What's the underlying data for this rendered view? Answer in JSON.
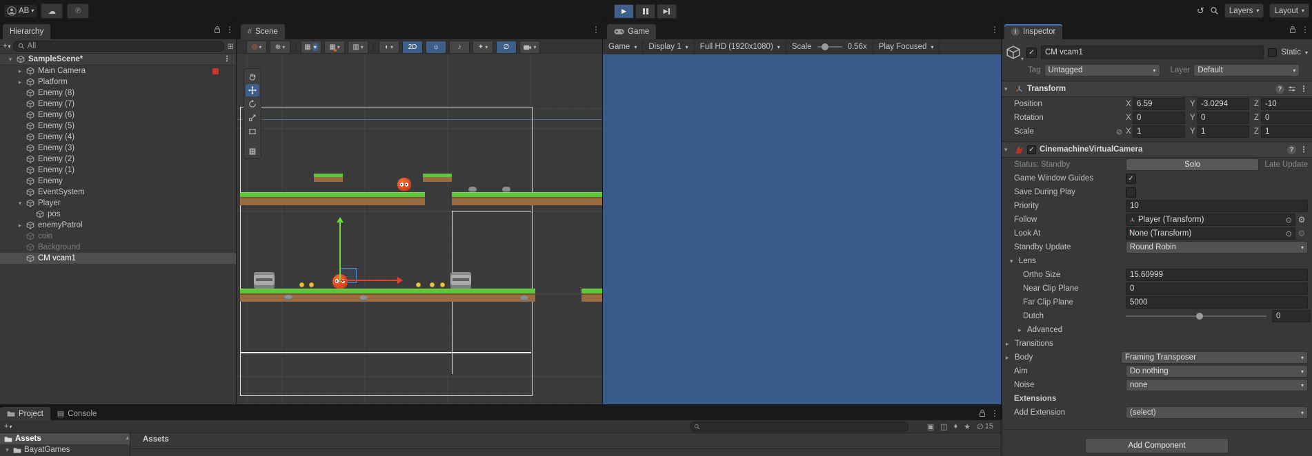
{
  "colors": {
    "chrome": "#191919",
    "panel": "#383838",
    "accent_blue": "#3d5f8a",
    "selection_gray": "#4d4d4d",
    "game_view_blue": "#3a5a8c",
    "focused_tab_blue": "#3c76c4",
    "grass_green": "#5dc73a",
    "dirt_brown": "#9a6b41",
    "player_orange": "#e8481c",
    "coin_yellow": "#edc940",
    "gizmo_green": "#6ade35",
    "gizmo_red": "#e0432c",
    "cinemachine_red": "#b5342c"
  },
  "icons": {
    "chevron_down": "▾",
    "chevron_right": "▸",
    "kebab": "⋮",
    "check": "✓",
    "cloud": "☁",
    "plastic_scm": "℗",
    "history": "↺",
    "plus": "+",
    "globe": "⊕",
    "grid": "▦",
    "ruler": "▥",
    "shaded_sphere": "◐",
    "light_bulb": "☼",
    "audio": "♪",
    "effects_star": "✦",
    "eye_hidden": "∅",
    "target": "⊙",
    "gear": "⚙",
    "link_broken": "⊘",
    "hash": "#",
    "console_lines": "▤",
    "star": "★",
    "frame_box": "▣",
    "package_box": "◫",
    "label_diamond": "♦",
    "help": "?",
    "info": "i",
    "up_arrow": "▴",
    "play": "▶"
  },
  "topbar": {
    "account_label": "AB",
    "layers_button": "Layers",
    "layout_button": "Layout"
  },
  "hierarchy": {
    "tab_label": "Hierarchy",
    "search_text": "All",
    "items": [
      {
        "label": "SampleScene*",
        "depth": 0,
        "arrow": "down",
        "scene": true,
        "kebab": true
      },
      {
        "label": "Main Camera",
        "depth": 1,
        "arrow": "right",
        "badge": true
      },
      {
        "label": "Platform",
        "depth": 1,
        "arrow": "right"
      },
      {
        "label": "Enemy (8)",
        "depth": 1
      },
      {
        "label": "Enemy (7)",
        "depth": 1
      },
      {
        "label": "Enemy (6)",
        "depth": 1
      },
      {
        "label": "Enemy (5)",
        "depth": 1
      },
      {
        "label": "Enemy (4)",
        "depth": 1
      },
      {
        "label": "Enemy (3)",
        "depth": 1
      },
      {
        "label": "Enemy (2)",
        "depth": 1
      },
      {
        "label": "Enemy (1)",
        "depth": 1
      },
      {
        "label": "Enemy",
        "depth": 1
      },
      {
        "label": "EventSystem",
        "depth": 1
      },
      {
        "label": "Player",
        "depth": 1,
        "arrow": "down"
      },
      {
        "label": "pos",
        "depth": 2
      },
      {
        "label": "enemyPatrol",
        "depth": 1,
        "arrow": "right"
      },
      {
        "label": "coin",
        "depth": 1,
        "dimmed": true
      },
      {
        "label": "Background",
        "depth": 1,
        "dimmed": true
      },
      {
        "label": "CM vcam1",
        "depth": 1,
        "selected": true
      }
    ]
  },
  "scene_panel": {
    "tab_label": "Scene",
    "toolbar_2d_label": "2D"
  },
  "game_panel": {
    "tab_label": "Game",
    "display_mode": "Game",
    "display_target": "Display 1",
    "resolution": "Full HD (1920x1080)",
    "scale_label": "Scale",
    "scale_value": "0.56x",
    "focus_mode": "Play Focused"
  },
  "inspector": {
    "tab_label": "Inspector",
    "go_name": "CM vcam1",
    "static_label": "Static",
    "tag_label": "Tag",
    "tag_value": "Untagged",
    "layer_label": "Layer",
    "layer_value": "Default",
    "transform": {
      "title": "Transform",
      "position_label": "Position",
      "rotation_label": "Rotation",
      "scale_label": "Scale",
      "axis_x": "X",
      "axis_y": "Y",
      "axis_z": "Z",
      "position": {
        "x": "6.59",
        "y": "-3.0294",
        "z": "-10"
      },
      "rotation": {
        "x": "0",
        "y": "0",
        "z": "0"
      },
      "scale": {
        "x": "1",
        "y": "1",
        "z": "1"
      }
    },
    "cinemachine": {
      "title": "CinemachineVirtualCamera",
      "status_label": "Status: Standby",
      "solo_button": "Solo",
      "late_update_label": "Late Update",
      "guides_label": "Game Window Guides",
      "save_label": "Save During Play",
      "priority_label": "Priority",
      "priority_value": "10",
      "follow_label": "Follow",
      "follow_value": "Player (Transform)",
      "look_at_label": "Look At",
      "look_at_value": "None (Transform)",
      "standby_label": "Standby Update",
      "standby_value": "Round Robin",
      "lens_label": "Lens",
      "ortho_label": "Ortho Size",
      "ortho_value": "15.60999",
      "near_label": "Near Clip Plane",
      "near_value": "0",
      "far_label": "Far Clip Plane",
      "far_value": "5000",
      "dutch_label": "Dutch",
      "dutch_value": "0",
      "advanced_label": "Advanced",
      "transitions_label": "Transitions",
      "body_label": "Body",
      "body_value": "Framing Transposer",
      "aim_label": "Aim",
      "aim_value": "Do nothing",
      "noise_label": "Noise",
      "noise_value": "none",
      "extensions_label": "Extensions",
      "add_extension_label": "Add Extension",
      "add_extension_value": "(select)"
    },
    "add_component_button": "Add Component"
  },
  "project_panel": {
    "tab_label": "Project",
    "console_tab_label": "Console",
    "assets_item": "Assets",
    "folder_item": "BayatGames",
    "column_header": "Assets",
    "hidden_count": "15"
  }
}
